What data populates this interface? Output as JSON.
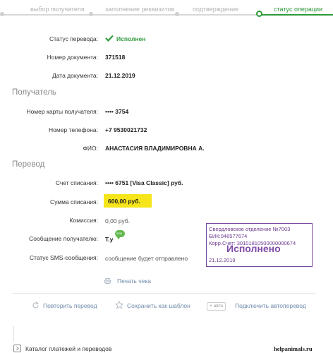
{
  "steps": [
    {
      "label": "выбор получателя",
      "active": false
    },
    {
      "label": "заполнение реквизитов",
      "active": false
    },
    {
      "label": "подтверждение",
      "active": false
    },
    {
      "label": "статус операции",
      "active": true
    }
  ],
  "status": {
    "label": "Статус перевода:",
    "value": "Исполнен",
    "color": "#2f9a3c"
  },
  "doc_number": {
    "label": "Номер документа:",
    "value": "371518"
  },
  "doc_date": {
    "label": "Дата документа:",
    "value": "21.12.2019"
  },
  "recipient": {
    "title": "Получатель",
    "card": {
      "label": "Номер карты получателя:",
      "value": "•••• 3754"
    },
    "phone": {
      "label": "Номер телефона:",
      "value": "+7 9530021732"
    },
    "fio": {
      "label": "ФИО:",
      "value": "АНАСТАСИЯ ВЛАДИМИРОВНА А."
    }
  },
  "transfer": {
    "title": "Перевод",
    "account": {
      "label": "Счет списания:",
      "value": "•••• 6751  [Visa Classic]  руб."
    },
    "sum": {
      "label": "Сумма списания:",
      "value": "600,00  руб.",
      "highlight": "#f6e51a"
    },
    "commission": {
      "label": "Комиссия:",
      "value": "0,00 руб."
    },
    "message": {
      "label": "Сообщение получателю:",
      "value": "Т.у",
      "bubble": "sms"
    },
    "sms": {
      "label": "Статус SMS-сообщения:",
      "value": "сообщение будет отправлено"
    }
  },
  "stamp": {
    "line1": "Свердловское отделение №7003",
    "line2": "БИК:046577674",
    "line3": "Корр.Счет: 30101810500000000674",
    "big": "Исполнено",
    "date": "21.12.2019",
    "color": "#7f4aa5"
  },
  "actions": {
    "print": "Печать чека",
    "repeat": "Повторить перевод",
    "template": "Сохранить как шаблон",
    "avto_badge": "+ авто",
    "autopay": "Подключить автоперевод"
  },
  "footer": {
    "catalog": "Каталог платежей и переводов",
    "watermark": "helpanimals.ru"
  }
}
